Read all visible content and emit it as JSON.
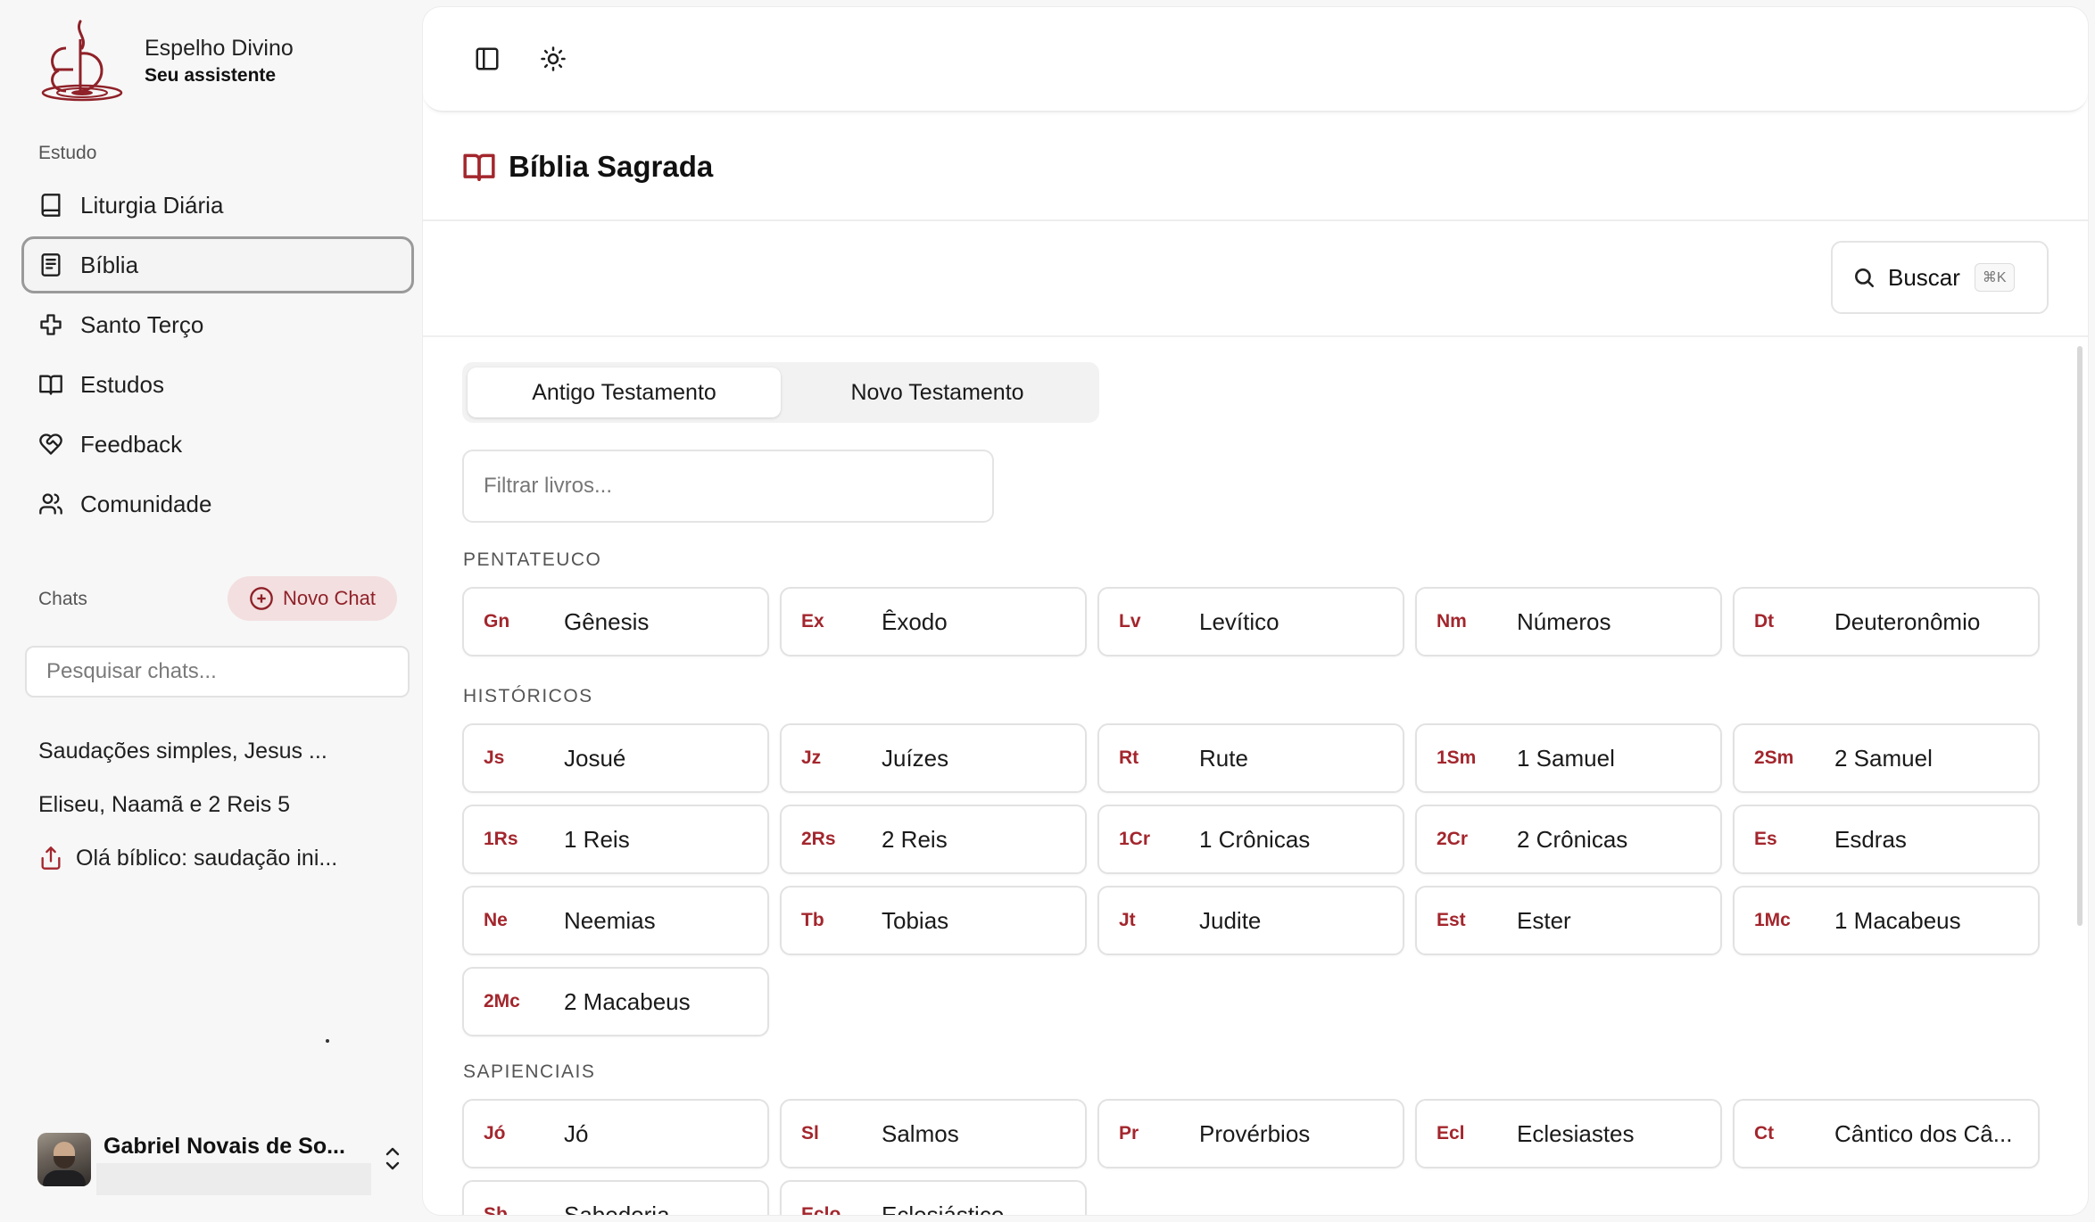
{
  "brand": {
    "title": "Espelho Divino",
    "subtitle": "Seu assistente"
  },
  "sidebar": {
    "study_label": "Estudo",
    "items": [
      {
        "label": "Liturgia Diária",
        "icon": "book-icon"
      },
      {
        "label": "Bíblia",
        "icon": "bible-icon",
        "active": true
      },
      {
        "label": "Santo Terço",
        "icon": "cross-icon"
      },
      {
        "label": "Estudos",
        "icon": "book-open-icon"
      },
      {
        "label": "Feedback",
        "icon": "heart-handshake-icon"
      },
      {
        "label": "Comunidade",
        "icon": "users-icon"
      }
    ],
    "chats_label": "Chats",
    "new_chat_label": "Novo Chat",
    "chat_search_placeholder": "Pesquisar chats...",
    "chats": [
      {
        "title": "Saudações simples, Jesus ..."
      },
      {
        "title": "Eliseu, Naamã e 2 Reis 5"
      },
      {
        "title": "Olá bíblico: saudação ini...",
        "icon": "share-icon"
      }
    ],
    "user": {
      "name": "Gabriel Novais de So..."
    }
  },
  "main": {
    "page_title": "Bíblia Sagrada",
    "search_label": "Buscar",
    "search_shortcut": "⌘K",
    "tabs": [
      {
        "label": "Antigo Testamento",
        "active": true
      },
      {
        "label": "Novo Testamento",
        "active": false
      }
    ],
    "filter_placeholder": "Filtrar livros...",
    "groups": [
      {
        "label": "PENTATEUCO",
        "books": [
          {
            "abbr": "Gn",
            "name": "Gênesis"
          },
          {
            "abbr": "Ex",
            "name": "Êxodo"
          },
          {
            "abbr": "Lv",
            "name": "Levítico"
          },
          {
            "abbr": "Nm",
            "name": "Números"
          },
          {
            "abbr": "Dt",
            "name": "Deuteronômio"
          }
        ]
      },
      {
        "label": "HISTÓRICOS",
        "books": [
          {
            "abbr": "Js",
            "name": "Josué"
          },
          {
            "abbr": "Jz",
            "name": "Juízes"
          },
          {
            "abbr": "Rt",
            "name": "Rute"
          },
          {
            "abbr": "1Sm",
            "name": "1 Samuel"
          },
          {
            "abbr": "2Sm",
            "name": "2 Samuel"
          },
          {
            "abbr": "1Rs",
            "name": "1 Reis"
          },
          {
            "abbr": "2Rs",
            "name": "2 Reis"
          },
          {
            "abbr": "1Cr",
            "name": "1 Crônicas"
          },
          {
            "abbr": "2Cr",
            "name": "2 Crônicas"
          },
          {
            "abbr": "Es",
            "name": "Esdras"
          },
          {
            "abbr": "Ne",
            "name": "Neemias"
          },
          {
            "abbr": "Tb",
            "name": "Tobias"
          },
          {
            "abbr": "Jt",
            "name": "Judite"
          },
          {
            "abbr": "Est",
            "name": "Ester"
          },
          {
            "abbr": "1Mc",
            "name": "1 Macabeus"
          },
          {
            "abbr": "2Mc",
            "name": "2 Macabeus"
          }
        ]
      },
      {
        "label": "SAPIENCIAIS",
        "books": [
          {
            "abbr": "Jó",
            "name": "Jó"
          },
          {
            "abbr": "Sl",
            "name": "Salmos"
          },
          {
            "abbr": "Pr",
            "name": "Provérbios"
          },
          {
            "abbr": "Ecl",
            "name": "Eclesiastes"
          },
          {
            "abbr": "Ct",
            "name": "Cântico dos Câ..."
          },
          {
            "abbr": "Sb",
            "name": "Sabedoria"
          },
          {
            "abbr": "Eclo",
            "name": "Eclesiástico"
          }
        ]
      }
    ]
  },
  "colors": {
    "accent": "#a3262d",
    "accent_soft": "#f3dfe0"
  }
}
